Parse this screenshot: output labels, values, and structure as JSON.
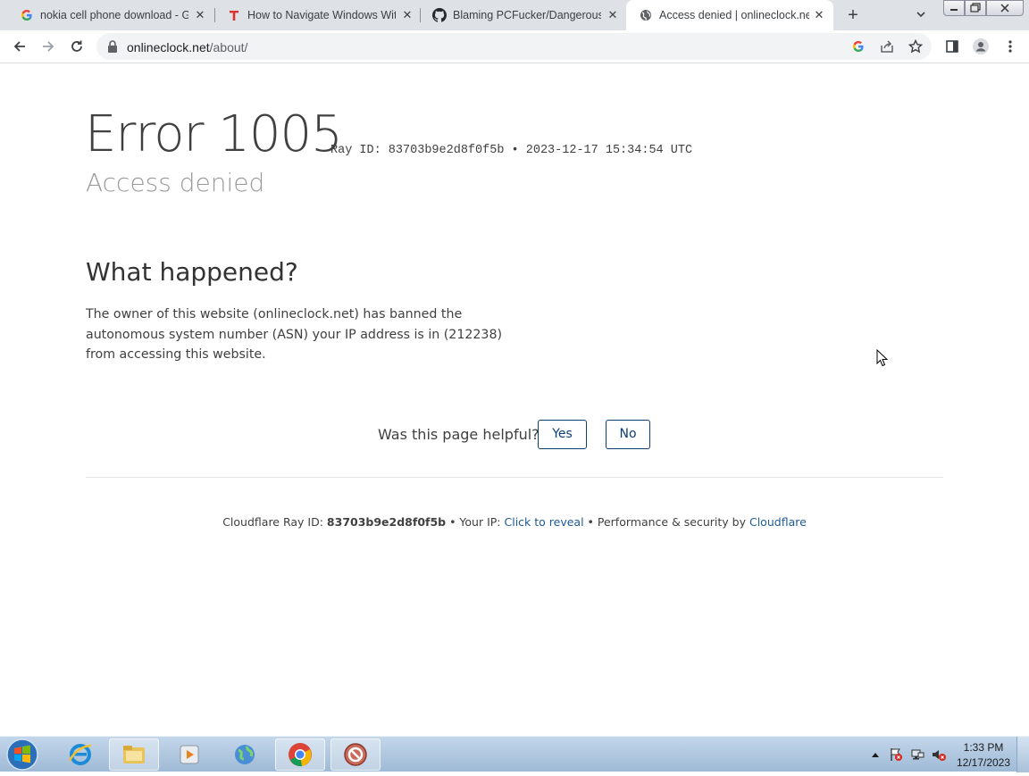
{
  "browser": {
    "tabs": [
      {
        "title": "nokia cell phone download - Go",
        "favicon": "google-g-icon"
      },
      {
        "title": "How to Navigate Windows With",
        "favicon": "t-logo-icon"
      },
      {
        "title": "Blaming PCFucker/Dangerous/N",
        "favicon": "github-icon"
      },
      {
        "title": "Access denied | onlineclock.net",
        "favicon": "globe-icon",
        "active": true
      }
    ],
    "url_host": "onlineclock.net",
    "url_path": "/about/"
  },
  "page": {
    "error_title": "Error 1005",
    "ray_line": "Ray ID: 83703b9e2d8f0f5b • 2023-12-17 15:34:54 UTC",
    "subtitle": "Access denied",
    "what_heading": "What happened?",
    "what_body": "The owner of this website (onlineclock.net) has banned the autonomous system number (ASN) your IP address is in (212238) from accessing this website.",
    "helpful_label": "Was this page helpful?",
    "yes_label": "Yes",
    "no_label": "No",
    "footer": {
      "ray_prefix": "Cloudflare Ray ID: ",
      "ray_value": "83703b9e2d8f0f5b",
      "ip_prefix": " • Your IP: ",
      "ip_link": "Click to reveal",
      "perf_prefix": " • Performance & security by ",
      "cf_link": "Cloudflare"
    }
  },
  "taskbar": {
    "clock_time": "1:33 PM",
    "clock_date": "12/17/2023"
  },
  "colors": {
    "link": "#1d5a96",
    "button_border": "#0b3e72",
    "tabstrip": "#dee1e6"
  }
}
